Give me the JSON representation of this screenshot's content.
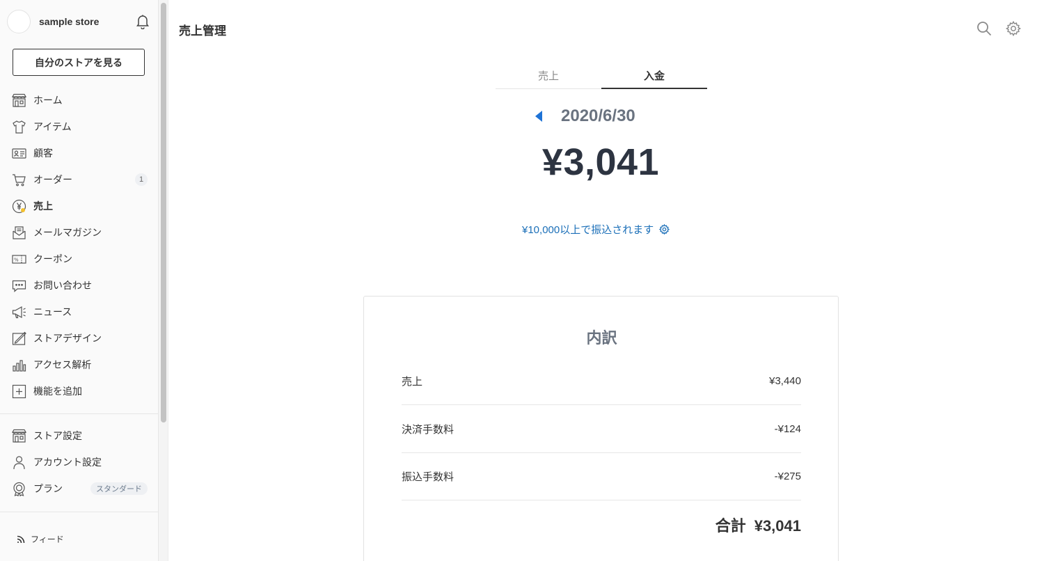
{
  "sidebar": {
    "store_name": "sample store",
    "view_store_label": "自分のストアを見る",
    "nav": [
      {
        "label": "ホーム",
        "icon": "store-icon"
      },
      {
        "label": "アイテム",
        "icon": "shirt-icon"
      },
      {
        "label": "顧客",
        "icon": "id-card-icon"
      },
      {
        "label": "オーダー",
        "icon": "cart-icon",
        "badge": "1"
      },
      {
        "label": "売上",
        "icon": "yen-coin-icon",
        "active": true
      },
      {
        "label": "メールマガジン",
        "icon": "mail-icon"
      },
      {
        "label": "クーポン",
        "icon": "coupon-icon"
      },
      {
        "label": "お問い合わせ",
        "icon": "chat-icon"
      },
      {
        "label": "ニュース",
        "icon": "megaphone-icon"
      },
      {
        "label": "ストアデザイン",
        "icon": "design-icon"
      },
      {
        "label": "アクセス解析",
        "icon": "bar-chart-icon"
      },
      {
        "label": "機能を追加",
        "icon": "plus-box-icon"
      }
    ],
    "settings": [
      {
        "label": "ストア設定",
        "icon": "store-icon"
      },
      {
        "label": "アカウント設定",
        "icon": "person-icon"
      },
      {
        "label": "プラン",
        "icon": "medal-icon",
        "badge": "スタンダード"
      }
    ],
    "feed_label": "フィード"
  },
  "header": {
    "title": "売上管理"
  },
  "tabs": [
    {
      "label": "売上",
      "active": false
    },
    {
      "label": "入金",
      "active": true
    }
  ],
  "payout": {
    "date": "2020/6/30",
    "amount": "¥3,041",
    "threshold_text": "¥10,000以上で振込されます"
  },
  "breakdown": {
    "title": "内訳",
    "rows": [
      {
        "label": "売上",
        "value": "¥3,440"
      },
      {
        "label": "決済手数料",
        "value": "-¥124"
      },
      {
        "label": "振込手数料",
        "value": "-¥275"
      }
    ],
    "total_label": "合計",
    "total_value": "¥3,041"
  },
  "colors": {
    "accent_link": "#1b6fb8",
    "arrow_blue": "#1e73d6",
    "text_dark": "#2d3441",
    "muted": "#6a7380",
    "coin_yellow": "#f3c12f"
  }
}
